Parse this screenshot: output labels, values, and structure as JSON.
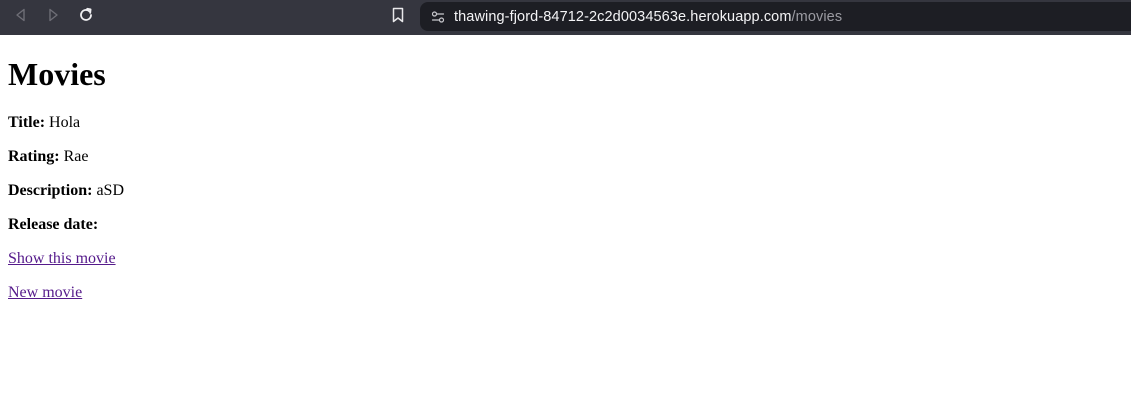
{
  "browser": {
    "url_host": "thawing-fjord-84712-2c2d0034563e.herokuapp.com",
    "url_path": "/movies",
    "icons": {
      "back": "back-arrow-icon",
      "forward": "forward-arrow-icon",
      "reload": "reload-icon",
      "bookmark": "bookmark-icon",
      "site_info": "site-settings-icon"
    },
    "colors": {
      "toolbar_bg": "#35363f",
      "address_bg": "#1d1e24",
      "url_host": "#f4f4f6",
      "url_path": "#9b9ba2"
    }
  },
  "page": {
    "title": "Movies",
    "movie": {
      "title_label": "Title:",
      "title_value": "Hola",
      "rating_label": "Rating:",
      "rating_value": "Rae",
      "description_label": "Description:",
      "description_value": "aSD",
      "release_label": "Release date:",
      "release_value": ""
    },
    "links": {
      "show_movie": "Show this movie",
      "new_movie": "New movie"
    },
    "colors": {
      "link_visited": "#551a8b"
    }
  }
}
